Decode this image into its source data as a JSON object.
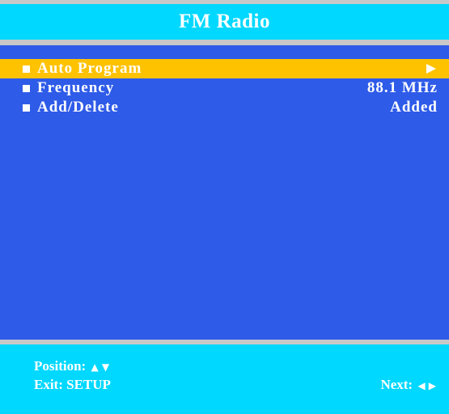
{
  "title": "FM Radio",
  "menu": {
    "items": [
      {
        "label": "Auto Program",
        "value": "",
        "icon": "play-icon",
        "selected": true
      },
      {
        "label": "Frequency",
        "value": "88.1 MHz",
        "selected": false
      },
      {
        "label": "Add/Delete",
        "value": "Added",
        "selected": false
      }
    ]
  },
  "footer": {
    "position_label": "Position:",
    "position_glyphs": "▲ ▼",
    "exit_label": "Exit: SETUP",
    "next_label": "Next:",
    "next_glyphs": "◀ ▶"
  },
  "colors": {
    "header_bg": "#00d8ff",
    "panel_bg": "#2e5be8",
    "highlight": "#ffc200",
    "separator": "#c8c8c8",
    "text": "#ffffff"
  }
}
